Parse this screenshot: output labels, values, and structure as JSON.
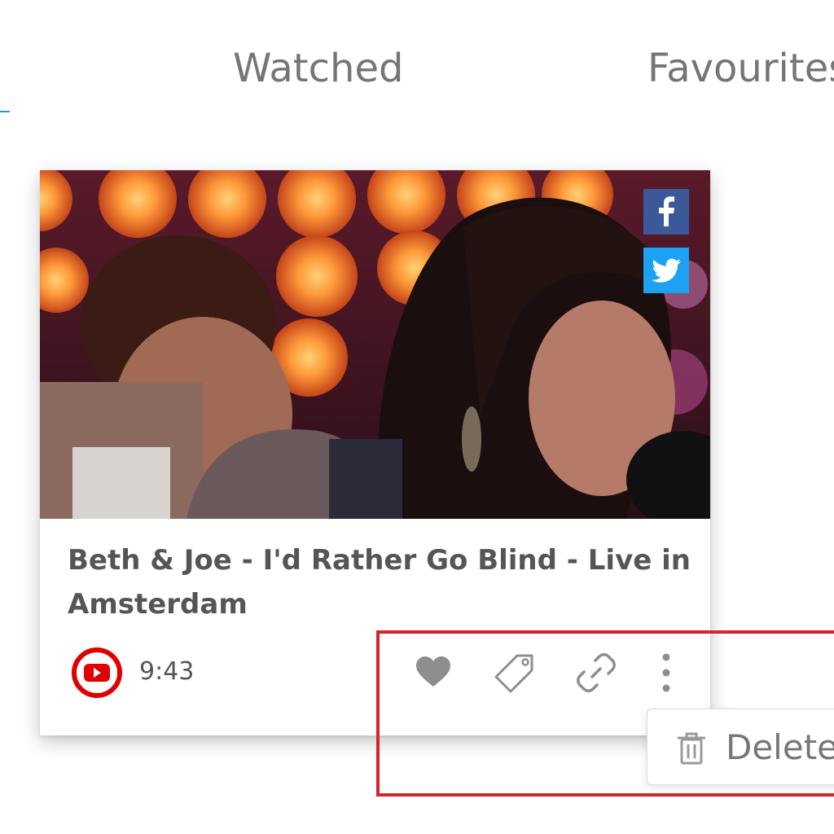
{
  "tabs": [
    {
      "label": "Watched"
    },
    {
      "label": "Favourites"
    }
  ],
  "card": {
    "title": "Beth & Joe - I'd Rather Go Blind - Live in Amsterdam",
    "source_icon": "youtube-icon",
    "duration": "9:43",
    "share": [
      "facebook-icon",
      "twitter-icon"
    ],
    "actions": [
      "heart-icon",
      "tag-icon",
      "link-icon",
      "more-vertical-icon"
    ]
  },
  "menu": {
    "delete_label": "Delete",
    "delete_icon": "trash-icon"
  },
  "colors": {
    "accent": "#1e9bd7",
    "highlight_border": "#d9202b",
    "youtube_red": "#e00000",
    "facebook": "#3b5998",
    "twitter": "#1da1f2"
  }
}
